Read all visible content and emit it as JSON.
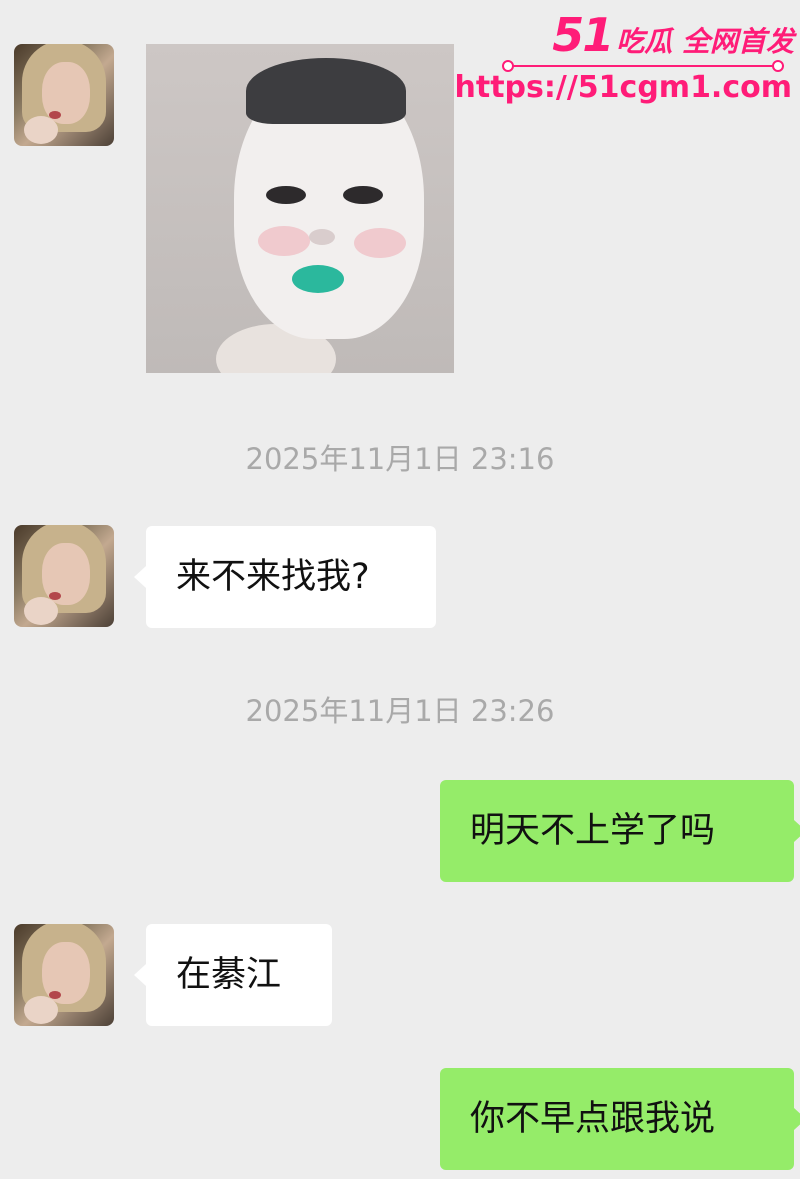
{
  "watermark": {
    "brand": "51",
    "tag": "吃瓜 全网首发",
    "url": "https://51cgm1.com"
  },
  "chat": {
    "timestamps": [
      "2025年11月1日 23:16",
      "2025年11月1日 23:26"
    ],
    "messages": [
      {
        "side": "left",
        "type": "image",
        "content": ""
      },
      {
        "side": "left",
        "type": "text",
        "text": "来不来找我?"
      },
      {
        "side": "right",
        "type": "text",
        "text": "明天不上学了吗"
      },
      {
        "side": "left",
        "type": "text",
        "text": "在綦江"
      },
      {
        "side": "right",
        "type": "text",
        "text": "你不早点跟我说"
      }
    ]
  },
  "colors": {
    "background": "#ededed",
    "received_bubble": "#ffffff",
    "sent_bubble": "#95ec69",
    "timestamp_text": "#a9a9a9",
    "watermark": "#ff1c78"
  }
}
